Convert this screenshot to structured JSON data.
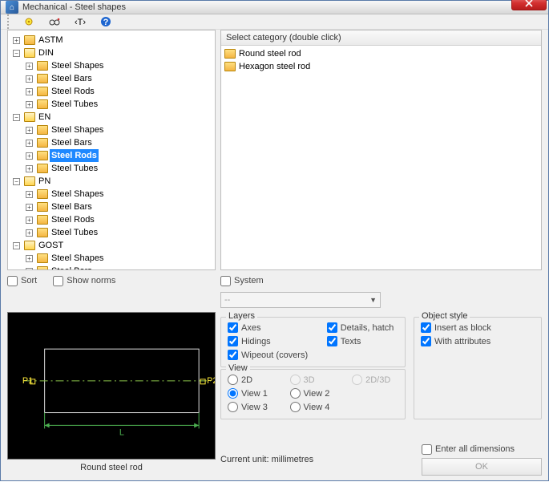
{
  "window": {
    "title": "Mechanical - Steel shapes"
  },
  "toolbar_icons": [
    "cog",
    "search",
    "text",
    "help"
  ],
  "tree": [
    {
      "label": "ASTM",
      "expanded": false,
      "children": []
    },
    {
      "label": "DIN",
      "expanded": true,
      "children": [
        {
          "label": "Steel Shapes",
          "children": []
        },
        {
          "label": "Steel Bars",
          "children": []
        },
        {
          "label": "Steel Rods",
          "children": []
        },
        {
          "label": "Steel Tubes",
          "children": []
        }
      ]
    },
    {
      "label": "EN",
      "expanded": true,
      "children": [
        {
          "label": "Steel Shapes",
          "children": []
        },
        {
          "label": "Steel Bars",
          "children": []
        },
        {
          "label": "Steel Rods",
          "selected": true,
          "children": []
        },
        {
          "label": "Steel Tubes",
          "children": []
        }
      ]
    },
    {
      "label": "PN",
      "expanded": true,
      "children": [
        {
          "label": "Steel Shapes",
          "children": []
        },
        {
          "label": "Steel Bars",
          "children": []
        },
        {
          "label": "Steel Rods",
          "children": []
        },
        {
          "label": "Steel Tubes",
          "children": []
        }
      ]
    },
    {
      "label": "GOST",
      "expanded": true,
      "children": [
        {
          "label": "Steel Shapes",
          "children": []
        },
        {
          "label": "Steel Bars",
          "children": []
        }
      ]
    }
  ],
  "list": {
    "header": "Select category (double click)",
    "items": [
      "Round steel rod",
      "Hexagon steel rod"
    ]
  },
  "sort_label": "Sort",
  "show_norms_label": "Show norms",
  "system_label": "System",
  "system_value": "--",
  "preview_label": "Round steel rod",
  "layers": {
    "legend": "Layers",
    "axes": "Axes",
    "axes_checked": true,
    "details": "Details, hatch",
    "details_checked": true,
    "hidings": "Hidings",
    "hidings_checked": true,
    "texts": "Texts",
    "texts_checked": true,
    "wipeout": "Wipeout (covers)",
    "wipeout_checked": true
  },
  "view": {
    "legend": "View",
    "2d": "2D",
    "3d": "3D",
    "2d3d": "2D/3D",
    "v1": "View 1",
    "v2": "View 2",
    "v3": "View 3",
    "v4": "View 4",
    "selected": "v1"
  },
  "object_style": {
    "legend": "Object style",
    "insert": "Insert as block",
    "insert_checked": true,
    "attrs": "With attributes",
    "attrs_checked": true
  },
  "enter_all_label": "Enter all dimensions",
  "current_unit": "Current unit: millimetres",
  "ok_label": "OK",
  "p1": "P1",
  "p2": "P2",
  "L": "L"
}
